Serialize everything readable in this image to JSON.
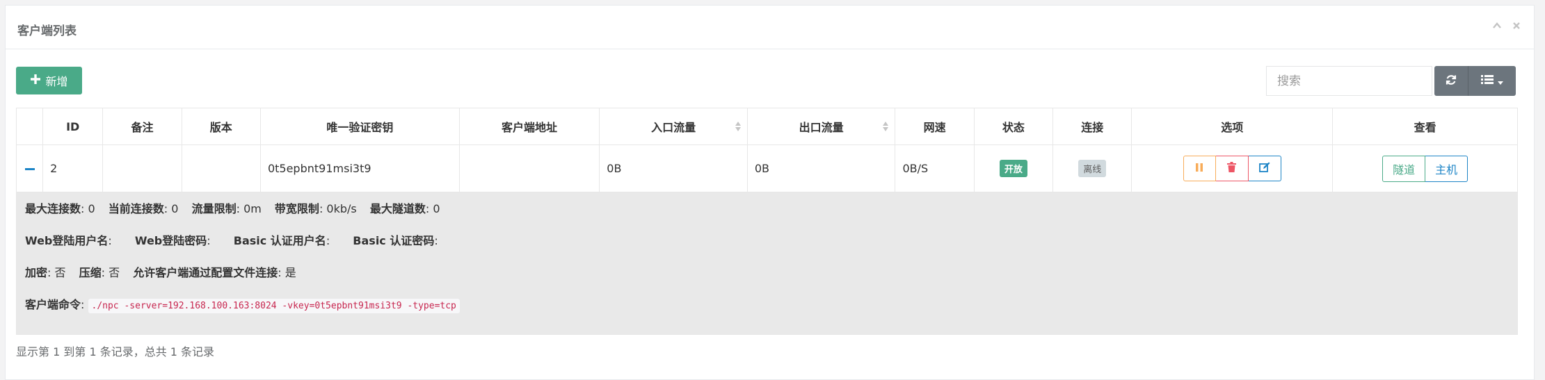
{
  "panel": {
    "title": "客户端列表"
  },
  "toolbar": {
    "add_label": "新增",
    "search_placeholder": "搜索"
  },
  "table": {
    "columns": [
      "ID",
      "备注",
      "版本",
      "唯一验证密钥",
      "客户端地址",
      "入口流量",
      "出口流量",
      "网速",
      "状态",
      "连接",
      "选项",
      "查看"
    ],
    "rows": [
      {
        "id": "2",
        "remark": "",
        "version": "",
        "vkey": "0t5epbnt91msi3t9",
        "address": "",
        "in_flow": "0B",
        "out_flow": "0B",
        "speed": "0B/S",
        "status": "开放",
        "connection": "离线",
        "view_tunnel": "隧道",
        "view_host": "主机"
      }
    ]
  },
  "detail": {
    "max_conn_label": "最大连接数",
    "max_conn": "0",
    "cur_conn_label": "当前连接数",
    "cur_conn": "0",
    "flow_limit_label": "流量限制",
    "flow_limit": "0m",
    "bw_limit_label": "带宽限制",
    "bw_limit": "0kb/s",
    "max_tunnel_label": "最大隧道数",
    "max_tunnel": "0",
    "web_user_label": "Web登陆用户名",
    "web_pass_label": "Web登陆密码",
    "basic_user_label": "Basic 认证用户名",
    "basic_pass_label": "Basic 认证密码",
    "encrypt_label": "加密",
    "encrypt": "否",
    "compress_label": "压缩",
    "compress": "否",
    "allow_config_label": "允许客户端通过配置文件连接",
    "allow_config": "是",
    "cmd_label": "客户端命令",
    "cmd": "./npc -server=192.168.100.163:8024 -vkey=0t5epbnt91msi3t9 -type=tcp"
  },
  "footer": {
    "summary": "显示第 1 到第 1 条记录，总共 1 条记录"
  },
  "colors": {
    "primary_green": "#4aaa88",
    "primary_blue": "#1c84c6",
    "warning": "#f8ac59",
    "danger": "#ed5565",
    "gray_button": "#6c757d"
  }
}
